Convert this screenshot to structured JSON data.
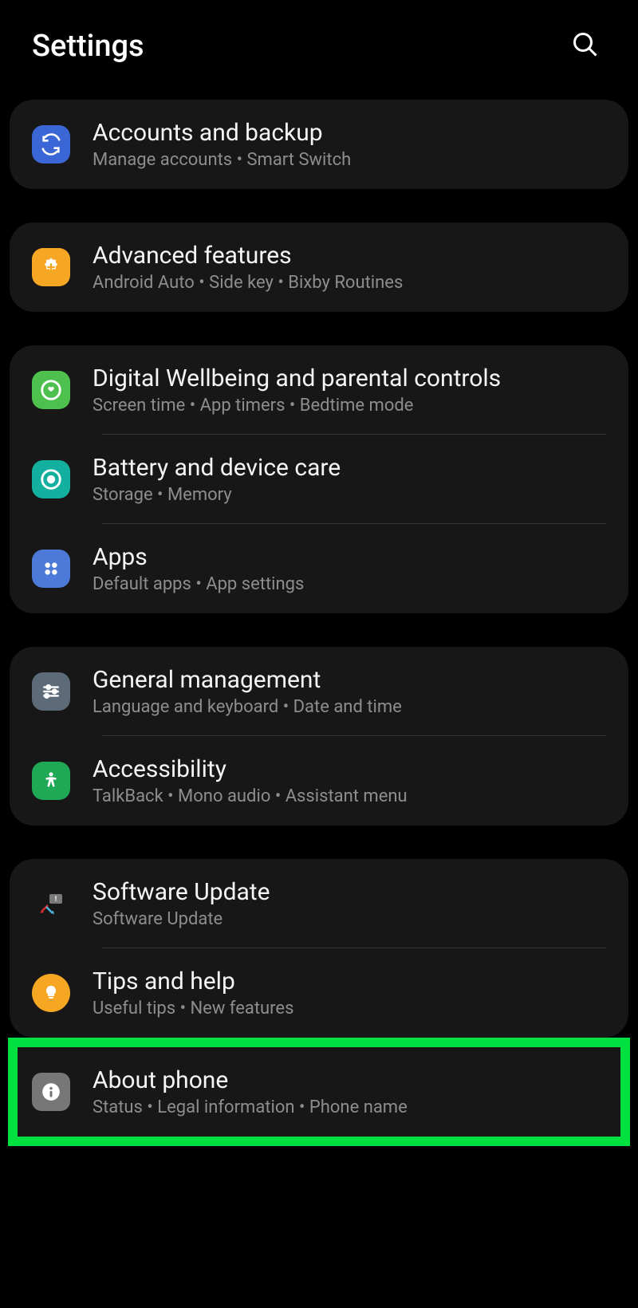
{
  "header": {
    "title": "Settings"
  },
  "groups": [
    {
      "items": [
        {
          "id": "accounts-backup",
          "title": "Accounts and backup",
          "subtitle": "Manage accounts  •  Smart Switch",
          "iconColor": "#3a66d6"
        }
      ]
    },
    {
      "items": [
        {
          "id": "advanced-features",
          "title": "Advanced features",
          "subtitle": "Android Auto  •  Side key  •  Bixby Routines",
          "iconColor": "#f5a623"
        }
      ]
    },
    {
      "items": [
        {
          "id": "digital-wellbeing",
          "title": "Digital Wellbeing and parental controls",
          "subtitle": "Screen time  •  App timers  •  Bedtime mode",
          "iconColor": "#4ec04e"
        },
        {
          "id": "battery-device-care",
          "title": "Battery and device care",
          "subtitle": "Storage  •  Memory",
          "iconColor": "#13b0a0"
        },
        {
          "id": "apps",
          "title": "Apps",
          "subtitle": "Default apps  •  App settings",
          "iconColor": "#4d7ad8"
        }
      ]
    },
    {
      "items": [
        {
          "id": "general-management",
          "title": "General management",
          "subtitle": "Language and keyboard  •  Date and time",
          "iconColor": "#5d6b79"
        },
        {
          "id": "accessibility",
          "title": "Accessibility",
          "subtitle": "TalkBack  •  Mono audio  •  Assistant menu",
          "iconColor": "#1fa855"
        }
      ]
    },
    {
      "items": [
        {
          "id": "software-update",
          "title": "Software Update",
          "subtitle": "Software Update",
          "iconColor": "transparent"
        },
        {
          "id": "tips-help",
          "title": "Tips and help",
          "subtitle": "Useful tips  •  New features",
          "iconColor": "#f5a623"
        }
      ]
    }
  ],
  "highlighted": {
    "id": "about-phone",
    "title": "About phone",
    "subtitle": "Status  •  Legal information  •  Phone name",
    "iconColor": "#777777"
  }
}
